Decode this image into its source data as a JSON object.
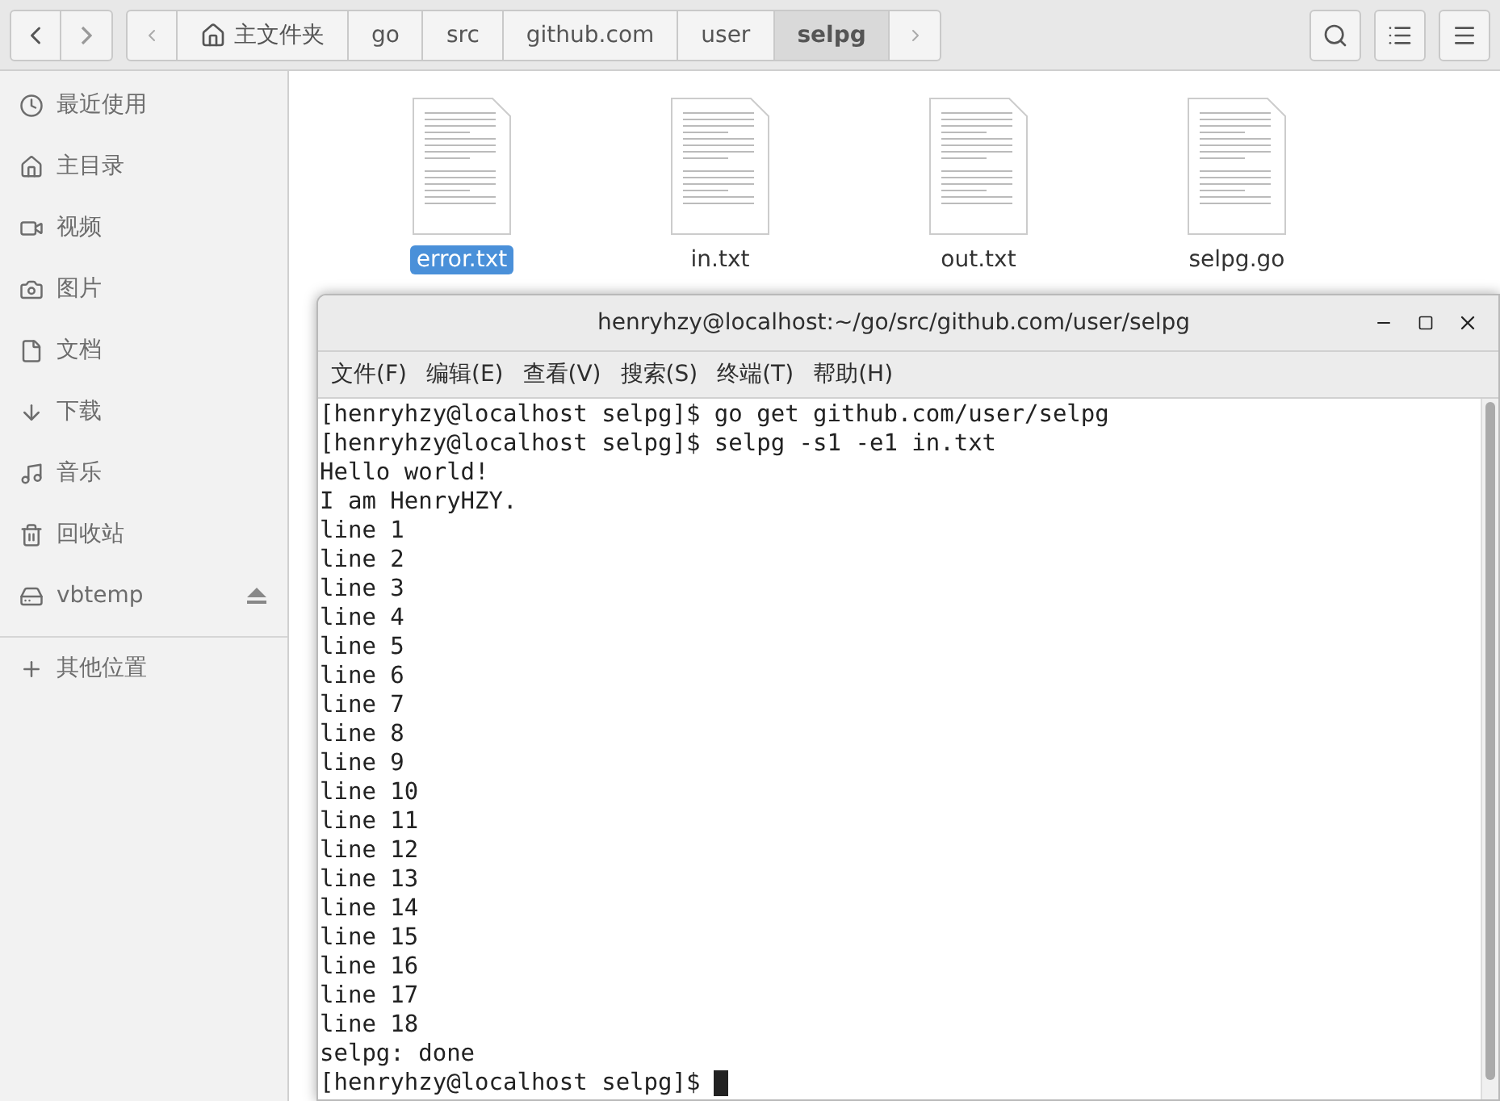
{
  "toolbar": {
    "path": [
      {
        "label": "主文件夹",
        "kind": "home",
        "selected": false
      },
      {
        "label": "go",
        "kind": "folder",
        "selected": false
      },
      {
        "label": "src",
        "kind": "folder",
        "selected": false
      },
      {
        "label": "github.com",
        "kind": "folder",
        "selected": false
      },
      {
        "label": "user",
        "kind": "folder",
        "selected": false
      },
      {
        "label": "selpg",
        "kind": "folder",
        "selected": true
      }
    ]
  },
  "sidebar": {
    "items": [
      {
        "label": "最近使用",
        "kind": "recent"
      },
      {
        "label": "主目录",
        "kind": "home"
      },
      {
        "label": "视频",
        "kind": "video"
      },
      {
        "label": "图片",
        "kind": "pictures"
      },
      {
        "label": "文档",
        "kind": "documents"
      },
      {
        "label": "下载",
        "kind": "downloads"
      },
      {
        "label": "音乐",
        "kind": "music"
      },
      {
        "label": "回收站",
        "kind": "trash"
      },
      {
        "label": "vbtemp",
        "kind": "drive"
      },
      {
        "label": "其他位置",
        "kind": "other"
      }
    ]
  },
  "files": [
    {
      "name": "error.txt",
      "selected": true
    },
    {
      "name": "in.txt",
      "selected": false
    },
    {
      "name": "out.txt",
      "selected": false
    },
    {
      "name": "selpg.go",
      "selected": false
    }
  ],
  "terminal": {
    "title": "henryhzy@localhost:~/go/src/github.com/user/selpg",
    "menu": [
      "文件(F)",
      "编辑(E)",
      "查看(V)",
      "搜索(S)",
      "终端(T)",
      "帮助(H)"
    ],
    "lines": [
      "[henryhzy@localhost selpg]$ go get github.com/user/selpg",
      "[henryhzy@localhost selpg]$ selpg -s1 -e1 in.txt",
      "Hello world!",
      "I am HenryHZY.",
      "line 1",
      "line 2",
      "line 3",
      "line 4",
      "line 5",
      "line 6",
      "line 7",
      "line 8",
      "line 9",
      "line 10",
      "line 11",
      "line 12",
      "line 13",
      "line 14",
      "line 15",
      "line 16",
      "line 17",
      "line 18",
      "selpg: done",
      "[henryhzy@localhost selpg]$ "
    ]
  }
}
